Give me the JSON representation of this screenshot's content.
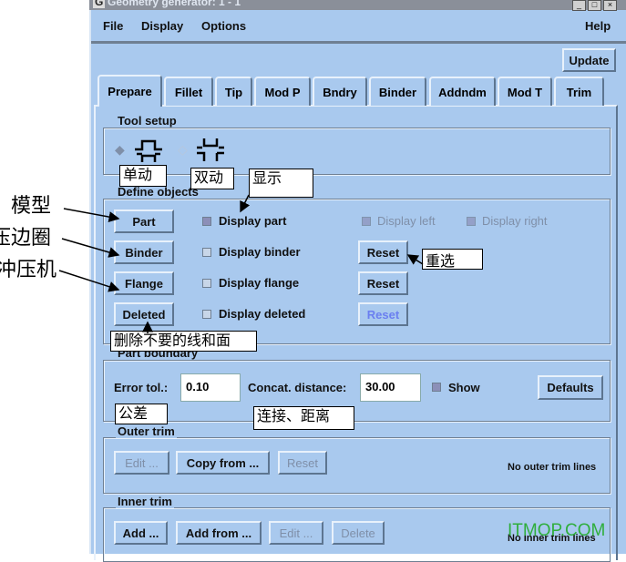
{
  "window": {
    "title": "Geometry generator: 1 - 1",
    "app_icon": "G"
  },
  "menu": {
    "file": "File",
    "display": "Display",
    "options": "Options",
    "help": "Help"
  },
  "update_label": "Update",
  "tabs": [
    "Prepare",
    "Fillet",
    "Tip",
    "Mod P",
    "Bndry",
    "Binder",
    "Addndm",
    "Mod T",
    "Trim"
  ],
  "tool_setup": {
    "title": "Tool setup",
    "options": [
      "single-action-tool-icon",
      "double-action-tool-icon"
    ]
  },
  "define_objects": {
    "title": "Define objects",
    "buttons": [
      "Part",
      "Binder",
      "Flange",
      "Deleted"
    ],
    "checks": [
      "Display part",
      "Display binder",
      "Display flange",
      "Display deleted"
    ],
    "display_left": "Display left",
    "display_right": "Display right",
    "reset": "Reset"
  },
  "part_boundary": {
    "title": "Part boundary",
    "error_label": "Error tol.:",
    "error_value": "0.10",
    "concat_label": "Concat. distance:",
    "concat_value": "30.00",
    "show": "Show",
    "defaults": "Defaults"
  },
  "outer_trim": {
    "title": "Outer trim",
    "edit": "Edit ...",
    "copy": "Copy from ...",
    "reset": "Reset",
    "status": "No outer trim lines"
  },
  "inner_trim": {
    "title": "Inner trim",
    "add": "Add ...",
    "add_from": "Add from ...",
    "edit": "Edit ...",
    "delete": "Delete",
    "status": "No inner trim lines"
  },
  "annotations": {
    "single": "单动",
    "double": "双动",
    "display": "显示",
    "reselect": "重选",
    "delete": "删除不要的线和面",
    "tolerance": "公差",
    "concat": "连接、距离",
    "model": "模型",
    "binder": "压边圈",
    "press": "冲压机"
  },
  "watermark": "ITMOP.COM"
}
